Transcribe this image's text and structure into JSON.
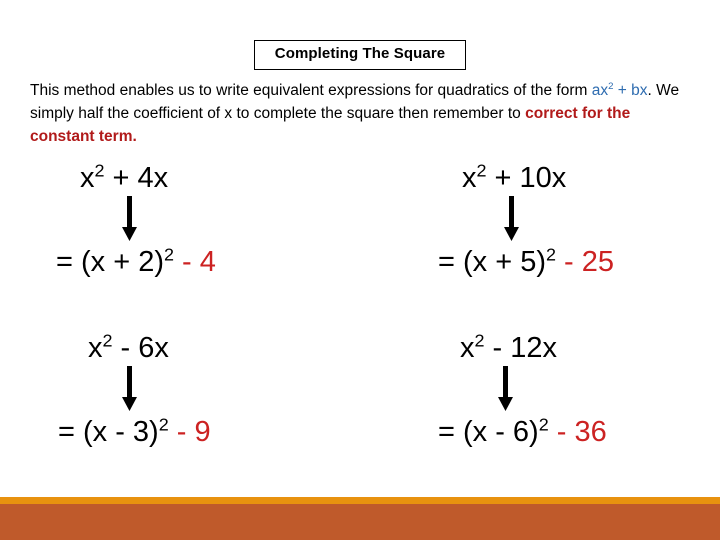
{
  "title": {
    "text": "Completing The Square"
  },
  "intro": {
    "part1": "This method enables us to write equivalent expressions for quadratics of the form ",
    "formula_a": "ax",
    "formula_sup": "2",
    "formula_b": " + bx",
    "part2": ". We simply half the coefficient of x to complete the square then remember to ",
    "highlight": "correct for the constant term.",
    "blue_color": "#2e6cb0",
    "red_color": "#b11a1a"
  },
  "examples": [
    {
      "id": "example-1",
      "top": {
        "base": "x",
        "exp": "2",
        "rest": " + 4x"
      },
      "arrow": "down-arrow-icon",
      "bottom": {
        "lead": "= (x + 2)",
        "exp": "2",
        "constant": " - 4"
      }
    },
    {
      "id": "example-2",
      "top": {
        "base": "x",
        "exp": "2",
        "rest": " + 10x"
      },
      "arrow": "down-arrow-icon",
      "bottom": {
        "lead": "= (x + 5)",
        "exp": "2",
        "constant": " - 25"
      }
    },
    {
      "id": "example-3",
      "top": {
        "base": "x",
        "exp": "2",
        "rest": " - 6x"
      },
      "arrow": "down-arrow-icon",
      "bottom": {
        "lead": "= (x - 3)",
        "exp": "2",
        "constant": " - 9"
      }
    },
    {
      "id": "example-4",
      "top": {
        "base": "x",
        "exp": "2",
        "rest": "  - 12x"
      },
      "arrow": "down-arrow-icon",
      "bottom": {
        "lead": "= (x - 6)",
        "exp": "2",
        "constant": " - 36"
      }
    }
  ],
  "footer": {
    "amber_color": "#e8920f",
    "terracotta_color": "#bf5a2b"
  }
}
